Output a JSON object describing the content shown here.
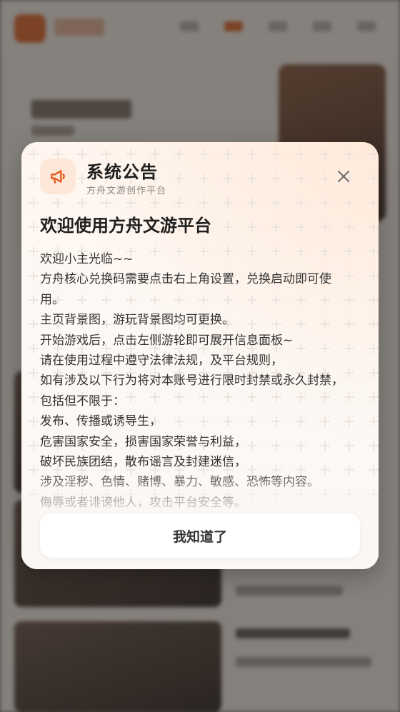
{
  "modal": {
    "title": "系统公告",
    "subtitle": "方舟文游创作平台",
    "header_icon": "megaphone-icon",
    "close_icon": "close-icon",
    "accent_color": "#e25a1c",
    "content_title": "欢迎使用方舟文游平台",
    "content_lines": [
      "欢迎小主光临~~",
      "方舟核心兑换码需要点击右上角设置，兑换启动即可使用。",
      "主页背景图，游玩背景图均可更换。",
      "开始游戏后，点击左侧游轮即可展开信息面板~",
      "请在使用过程中遵守法律法规，及平台规则，",
      "如有涉及以下行为将对本账号进行限时封禁或永久封禁，包括但不限于：",
      "发布、传播或诱导生，",
      "危害国家安全，损害国家荣誉与利益，",
      "破坏民族团结，散布谣言及封建迷信，",
      "涉及淫秽、色情、赌博、暴力、敏感、恐怖等内容。",
      "侮辱或者诽谤他人，攻击平台安全等。"
    ],
    "confirm_label": "我知道了"
  }
}
